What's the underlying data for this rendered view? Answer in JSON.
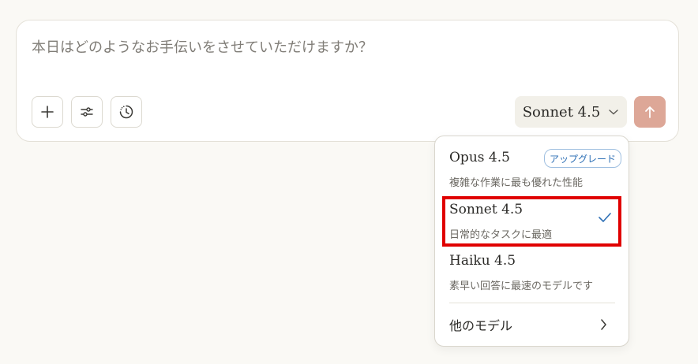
{
  "composer": {
    "placeholder": "本日はどのようなお手伝いをさせていただけますか？",
    "model_label": "Sonnet 4.5"
  },
  "icons": {
    "add": "plus-icon",
    "settings": "sliders-icon",
    "history": "clock-icon",
    "chevron": "chevron-down-icon",
    "send": "arrow-up-icon"
  },
  "menu": {
    "options": [
      {
        "name": "Opus 4.5",
        "desc": "複雑な作業に最も優れた性能",
        "badge": "アップグレード"
      },
      {
        "name": "Sonnet 4.5",
        "desc": "日常的なタスクに最適",
        "selected": true
      },
      {
        "name": "Haiku 4.5",
        "desc": "素早い回答に最速のモデルです"
      }
    ],
    "more_label": "他のモデル"
  },
  "colors": {
    "background": "#faf9f5",
    "send_button": "#dda797",
    "highlight": "#e00000",
    "check": "#2d6fb5"
  }
}
